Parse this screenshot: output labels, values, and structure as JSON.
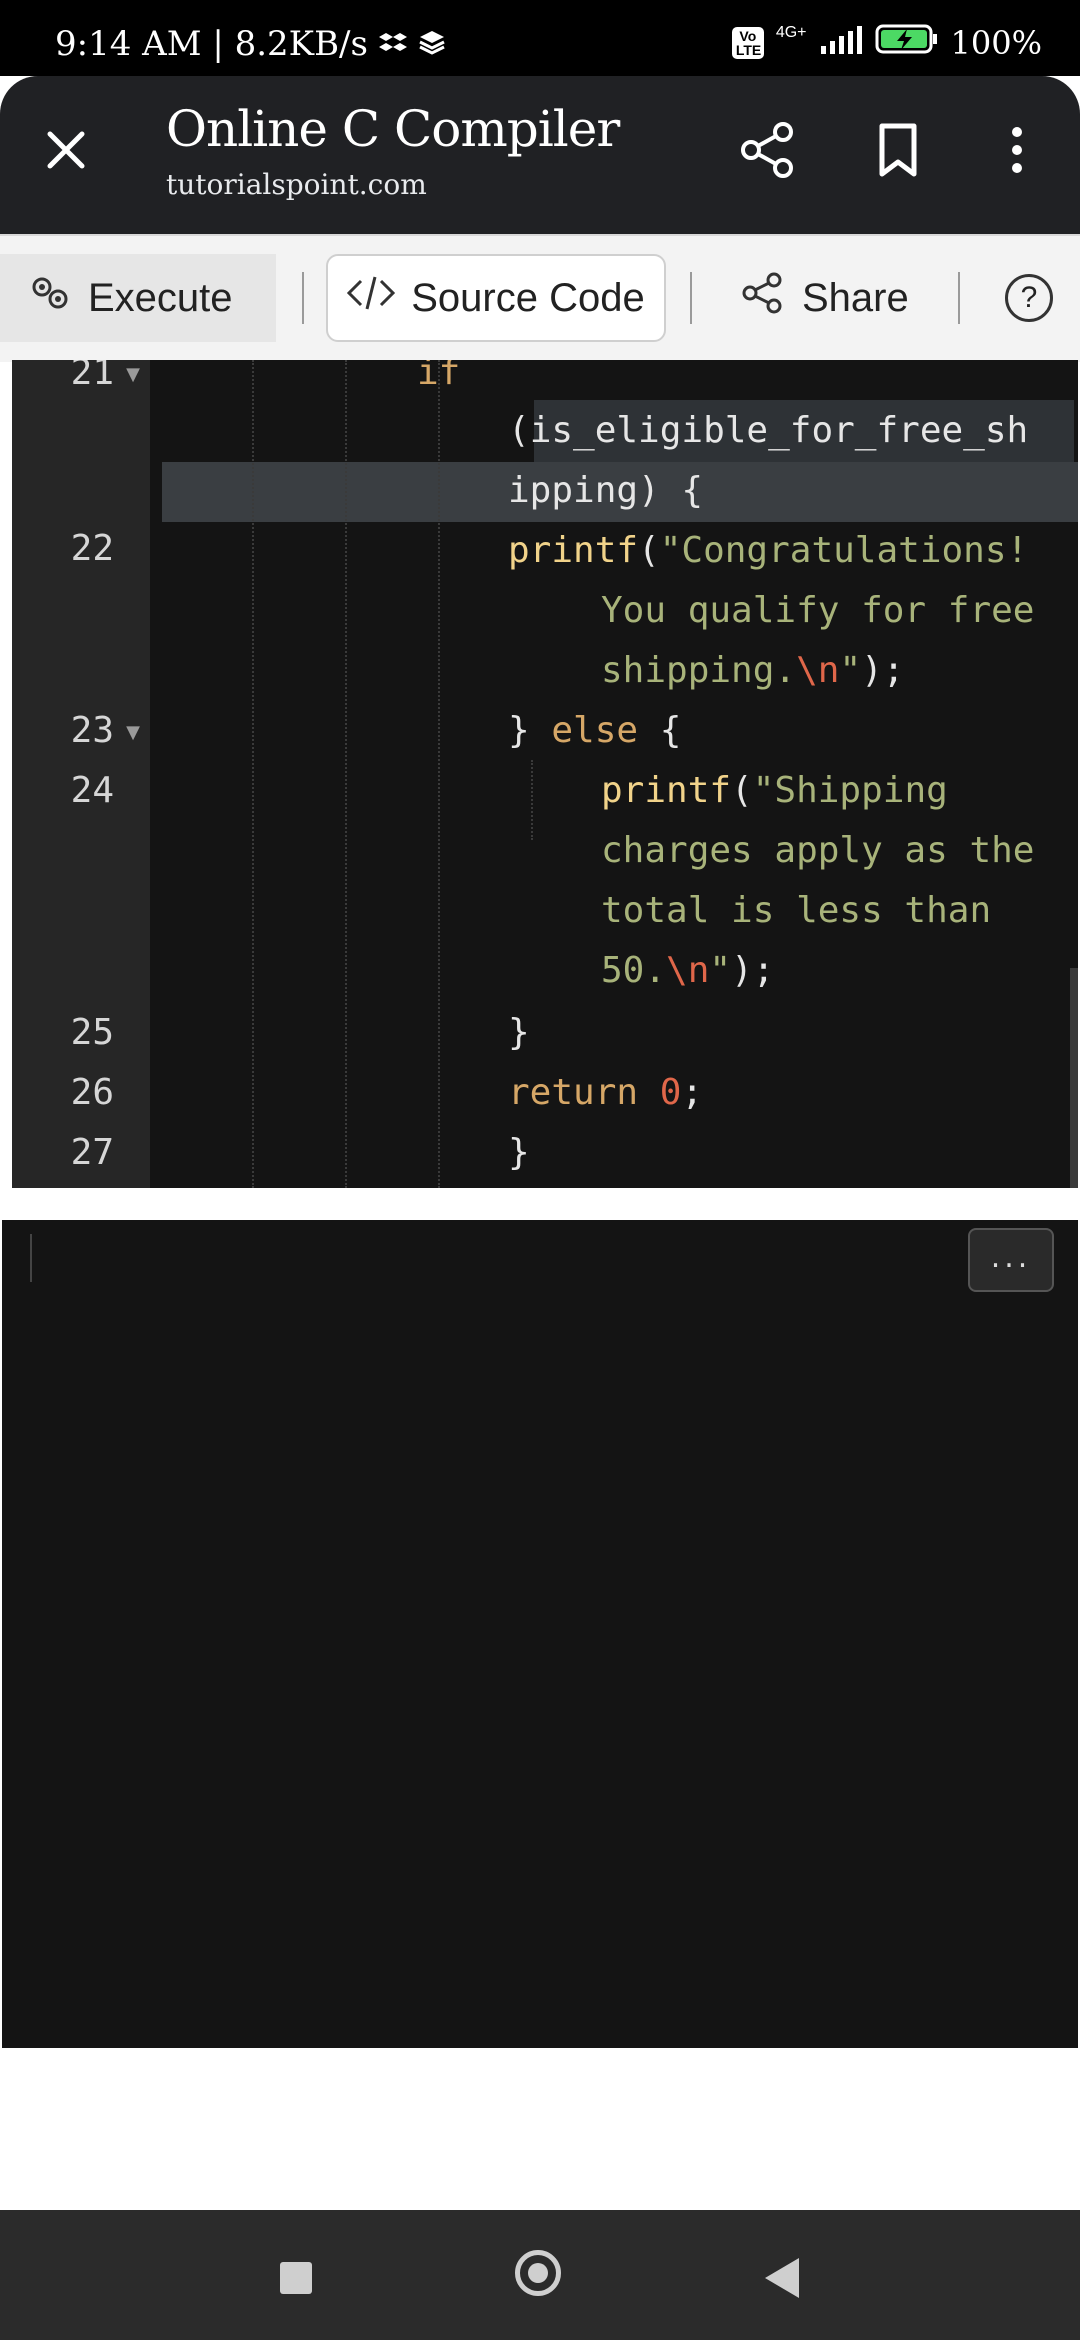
{
  "status_bar": {
    "time_speed": "9:14 AM | 8.2KB/s",
    "network": "4G+",
    "volte": "Vo LTE",
    "battery": "100%"
  },
  "browser": {
    "title": "Online C Compiler",
    "domain": "tutorialspoint.com",
    "icons": [
      "close-icon",
      "share-icon",
      "bookmark-icon",
      "more-vert-icon"
    ]
  },
  "toolbar": {
    "execute_label": "Execute",
    "source_label": "Source Code",
    "share_label": "Share",
    "help_label": "?"
  },
  "editor": {
    "line_numbers": [
      "21",
      "22",
      "23",
      "24",
      "25",
      "26",
      "27"
    ],
    "code": {
      "l21a": "if",
      "l21b_open": "(",
      "l21b_ident": "is_eligible_for_free_sh",
      "l21c_ident": "ipping",
      "l21c_rest": ") {",
      "l22a_fn": "printf",
      "l22a_paren": "(",
      "l22a_str": "\"Congratulations!",
      "l22b_str": "You qualify for free",
      "l22c_str": "shipping.",
      "l22c_esc": "\\n",
      "l22c_end": "\"",
      "l22c_tail": ");",
      "l23_brace": "}",
      "l23_else": "else",
      "l23_open": "{",
      "l24a_fn": "printf",
      "l24a_paren": "(",
      "l24a_str": "\"Shipping",
      "l24b_str": "charges apply as the",
      "l24c_str": "total is less than",
      "l24d_str": "50.",
      "l24d_esc": "\\n",
      "l24d_end": "\"",
      "l24d_tail": ");",
      "l25": "}",
      "l26_kw": "return",
      "l26_num": "0",
      "l26_tail": ";",
      "l27": "}"
    }
  },
  "console": {
    "more_label": "..."
  },
  "nav": {
    "icons": [
      "recents-icon",
      "home-icon",
      "back-icon"
    ]
  }
}
